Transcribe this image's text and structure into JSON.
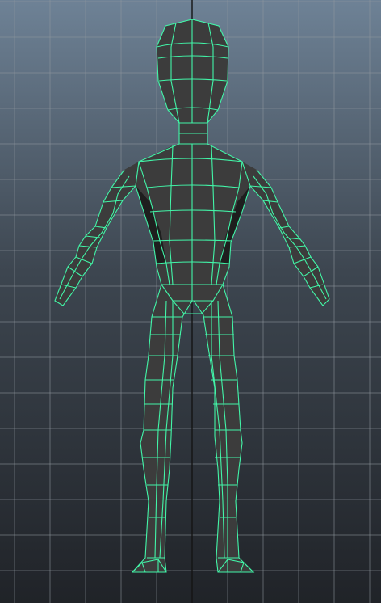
{
  "viewport": {
    "background_top": "#6e8296",
    "background_mid": "#3d4650",
    "background_bottom": "#202328",
    "grid_color": "#8f979f",
    "axis_color": "#141414"
  },
  "model": {
    "surface_color": "#3c3c3c",
    "surface_shadow_color": "#1e1e1e",
    "wireframe_color": "#42f5a8",
    "selection_state": "selected"
  }
}
